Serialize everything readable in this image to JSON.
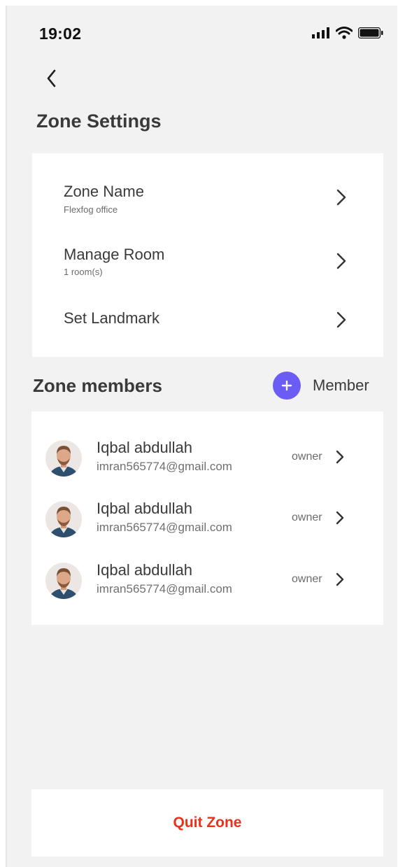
{
  "status": {
    "time": "19:02"
  },
  "header": {
    "title": "Zone Settings"
  },
  "settings": [
    {
      "label": "Zone Name",
      "sub": "Flexfog office"
    },
    {
      "label": "Manage Room",
      "sub": "1 room(s)"
    },
    {
      "label": "Set Landmark",
      "sub": ""
    }
  ],
  "members": {
    "title": "Zone members",
    "add_label": "Member",
    "items": [
      {
        "name": "Iqbal abdullah",
        "email": "imran565774@gmail.com",
        "role": "owner"
      },
      {
        "name": "Iqbal abdullah",
        "email": "imran565774@gmail.com",
        "role": "owner"
      },
      {
        "name": "Iqbal abdullah",
        "email": "imran565774@gmail.com",
        "role": "owner"
      }
    ]
  },
  "footer": {
    "quit_label": "Quit Zone"
  },
  "colors": {
    "accent": "#6a5cf5",
    "danger": "#e8321c",
    "background": "#f2f2f2"
  },
  "icons": [
    "back-arrow-icon",
    "chevron-right-icon",
    "plus-icon",
    "signal-icon",
    "wifi-icon",
    "battery-icon"
  ]
}
